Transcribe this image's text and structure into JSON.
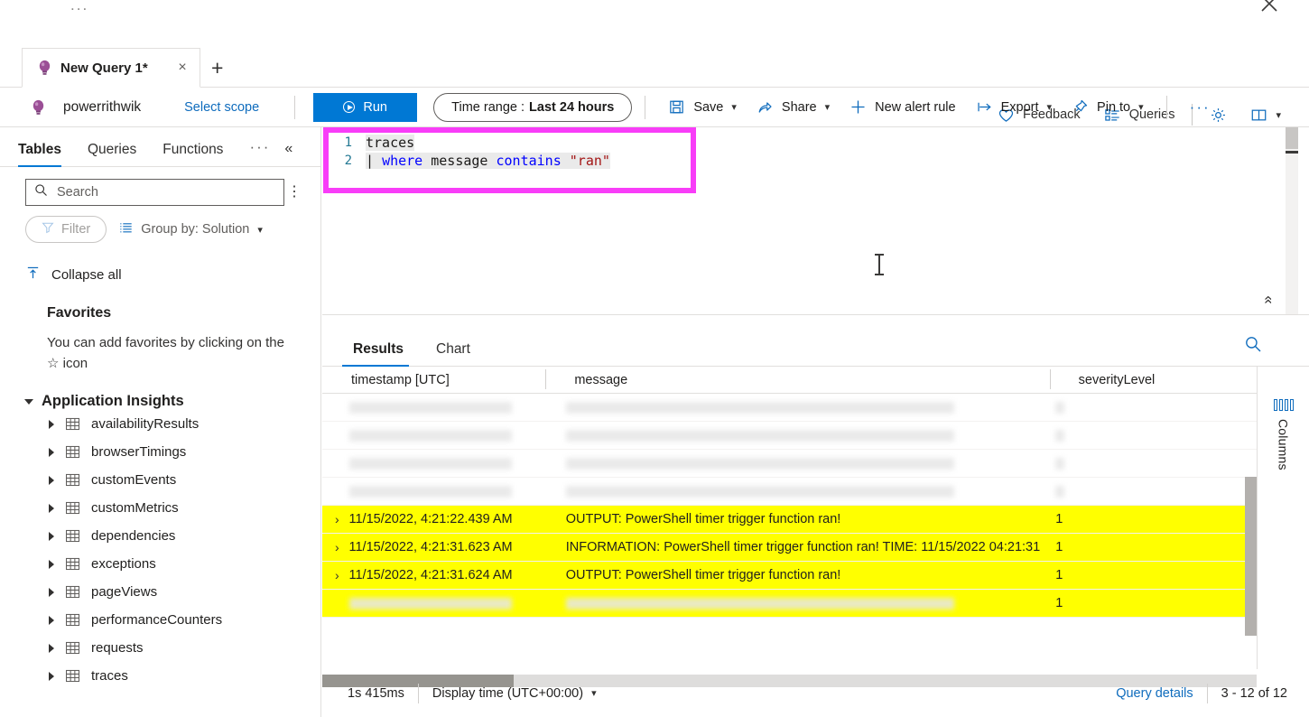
{
  "window": {
    "overflow_ellipsis": "...",
    "close_icon": "close-icon"
  },
  "tabs": {
    "query_tab_label": "New Query 1*",
    "close_label": "×",
    "add_label": "+"
  },
  "header_actions": [
    {
      "label": "Feedback",
      "icon": "heart-icon"
    },
    {
      "label": "Queries",
      "icon": "queries-list-icon"
    },
    {
      "label": "",
      "icon": "gear-icon"
    },
    {
      "label": "",
      "icon": "book-icon"
    },
    {
      "label": "",
      "icon": "chevron-down-icon"
    }
  ],
  "scope": {
    "resource_name": "powerrithwik",
    "resource_icon": "app-insights-bulb-icon",
    "select_scope_label": "Select scope"
  },
  "toolbar": {
    "run_label": "Run",
    "time_range_prefix": "Time range :",
    "time_range_value": "Last 24 hours",
    "save_label": "Save",
    "share_label": "Share",
    "new_alert_rule_label": "New alert rule",
    "export_label": "Export",
    "pin_to_label": "Pin to",
    "more_label": "···"
  },
  "left_pane": {
    "tabs": [
      {
        "label": "Tables",
        "active": true
      },
      {
        "label": "Queries",
        "active": false
      },
      {
        "label": "Functions",
        "active": false
      }
    ],
    "more_label": "···",
    "collapse_pane_label": "«",
    "search": {
      "placeholder": "Search",
      "value": "",
      "icon": "search-icon"
    },
    "kebab_label": "⋮",
    "filter_label": "Filter",
    "group_by_label": "Group by: Solution",
    "collapse_all_label": "Collapse all",
    "favorites_heading": "Favorites",
    "favorites_empty_text": "You can add favorites by clicking on the ☆ icon",
    "group_heading": "Application Insights",
    "tables": [
      {
        "name": "availabilityResults"
      },
      {
        "name": "browserTimings"
      },
      {
        "name": "customEvents"
      },
      {
        "name": "customMetrics"
      },
      {
        "name": "dependencies"
      },
      {
        "name": "exceptions"
      },
      {
        "name": "pageViews"
      },
      {
        "name": "performanceCounters"
      },
      {
        "name": "requests"
      },
      {
        "name": "traces"
      }
    ]
  },
  "editor": {
    "lines": [
      {
        "num": "1",
        "tokens": [
          {
            "t": "traces",
            "c": "k-tbl"
          }
        ]
      },
      {
        "num": "2",
        "tokens": [
          {
            "t": "| ",
            "c": "k-op"
          },
          {
            "t": "where",
            "c": "k-kw"
          },
          {
            "t": " message ",
            "c": "k-id"
          },
          {
            "t": "contains",
            "c": "k-fn"
          },
          {
            "t": " ",
            "c": "k-id"
          },
          {
            "t": "\"ran\"",
            "c": "k-str"
          }
        ]
      }
    ],
    "collapse_label": "«"
  },
  "highlight": {
    "color": "#f83df8",
    "row_highlight_color": "#ffff00"
  },
  "results": {
    "tabs": [
      {
        "label": "Results",
        "active": true
      },
      {
        "label": "Chart",
        "active": false
      }
    ],
    "search_icon": "search-icon",
    "columns": [
      {
        "label": "timestamp [UTC]"
      },
      {
        "label": "message"
      },
      {
        "label": "severityLevel"
      }
    ],
    "rows": [
      {
        "redacted": true,
        "timestamp": "",
        "message": "",
        "severityLevel": "",
        "highlight": false
      },
      {
        "redacted": true,
        "timestamp": "",
        "message": "",
        "severityLevel": "",
        "highlight": false
      },
      {
        "redacted": true,
        "timestamp": "",
        "message": "",
        "severityLevel": "",
        "highlight": false
      },
      {
        "redacted": true,
        "timestamp": "",
        "message": "",
        "severityLevel": "",
        "highlight": false
      },
      {
        "redacted": false,
        "timestamp": "11/15/2022, 4:21:22.439 AM",
        "message": "OUTPUT: PowerShell timer trigger function ran!",
        "severityLevel": "1",
        "highlight": true
      },
      {
        "redacted": false,
        "timestamp": "11/15/2022, 4:21:31.623 AM",
        "message": "INFORMATION: PowerShell timer trigger function ran! TIME: 11/15/2022 04:21:31",
        "severityLevel": "1",
        "highlight": true
      },
      {
        "redacted": false,
        "timestamp": "11/15/2022, 4:21:31.624 AM",
        "message": "OUTPUT: PowerShell timer trigger function ran!",
        "severityLevel": "1",
        "highlight": true
      },
      {
        "redacted": true,
        "timestamp": "",
        "message": "",
        "severityLevel": "1",
        "highlight": true
      }
    ],
    "expand_glyph": "›",
    "columns_panel": {
      "label": "Columns",
      "icon": "columns-icon"
    }
  },
  "status_bar": {
    "duration": "1s 415ms",
    "display_time_label": "Display time (UTC+00:00)",
    "query_details_label": "Query details",
    "record_range": "3 - 12 of 12"
  }
}
